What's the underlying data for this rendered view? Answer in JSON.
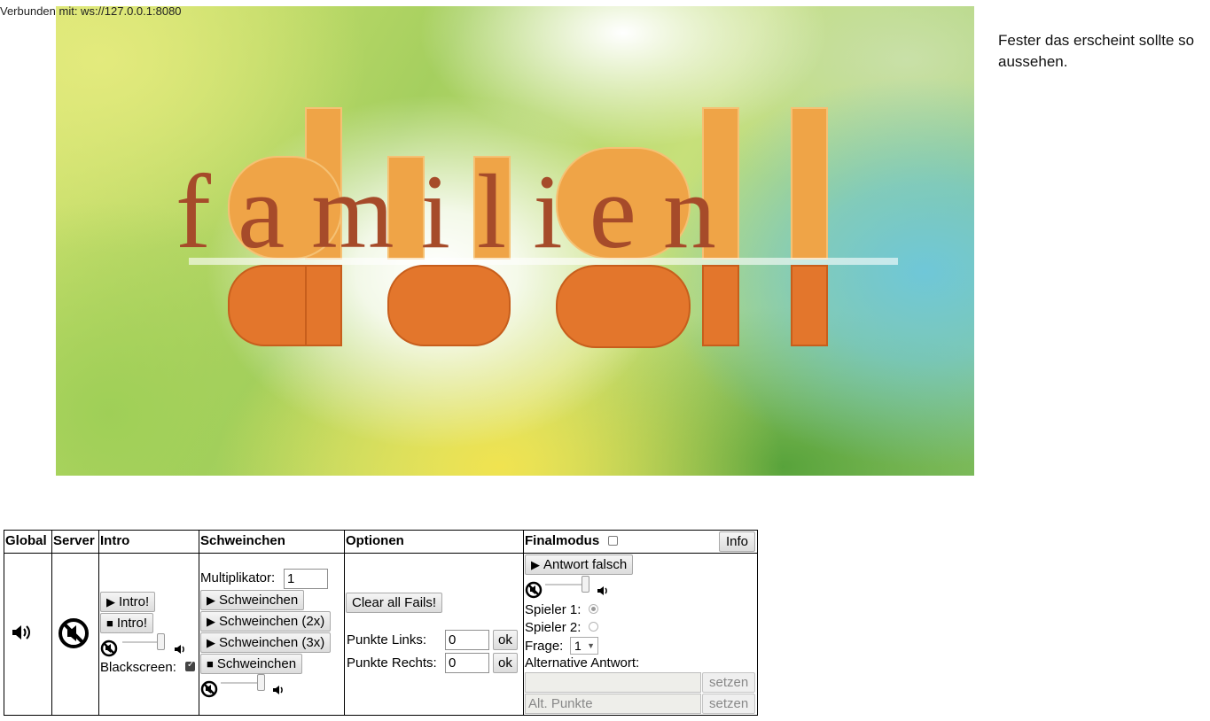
{
  "status": "Verbunden mit: ws://127.0.0.1:8080",
  "banner": {
    "word_top": "famil",
    "word_top2": "ien",
    "word_big": "duell"
  },
  "side_note": "Fester das erscheint sollte so aussehen.",
  "colors": {
    "orange_light": "#efa447",
    "orange_dark": "#e3762c",
    "brown": "#a64b2a"
  },
  "table": {
    "headers": {
      "global": "Global",
      "server": "Server",
      "intro": "Intro",
      "schweinchen": "Schweinchen",
      "optionen": "Optionen",
      "finalmodus": "Finalmodus"
    },
    "info_label": "Info",
    "intro": {
      "play_label": "Intro!",
      "stop_label": "Intro!",
      "volume": 0.8,
      "blackscreen_label": "Blackscreen:",
      "blackscreen_checked": true
    },
    "schweinchen": {
      "multiplikator_label": "Multiplikator:",
      "multiplikator_value": "1",
      "btn1": "Schweinchen",
      "btn2": "Schweinchen (2x)",
      "btn3": "Schweinchen (3x)",
      "stop": "Schweinchen",
      "volume": 0.8
    },
    "optionen": {
      "clear_label": "Clear all Fails!",
      "links_label": "Punkte Links:",
      "links_value": "0",
      "rechts_label": "Punkte Rechts:",
      "rechts_value": "0",
      "ok_label": "ok"
    },
    "final": {
      "checked": false,
      "antwort_falsch": "Antwort falsch",
      "volume": 0.8,
      "spieler1": "Spieler 1:",
      "spieler1_selected": true,
      "spieler2": "Spieler 2:",
      "spieler2_selected": false,
      "frage_label": "Frage:",
      "frage_value": "1",
      "alt_label": "Alternative Antwort:",
      "alt_placeholder": "",
      "alt_punkte_placeholder": "Alt. Punkte",
      "setzen_label": "setzen"
    }
  }
}
